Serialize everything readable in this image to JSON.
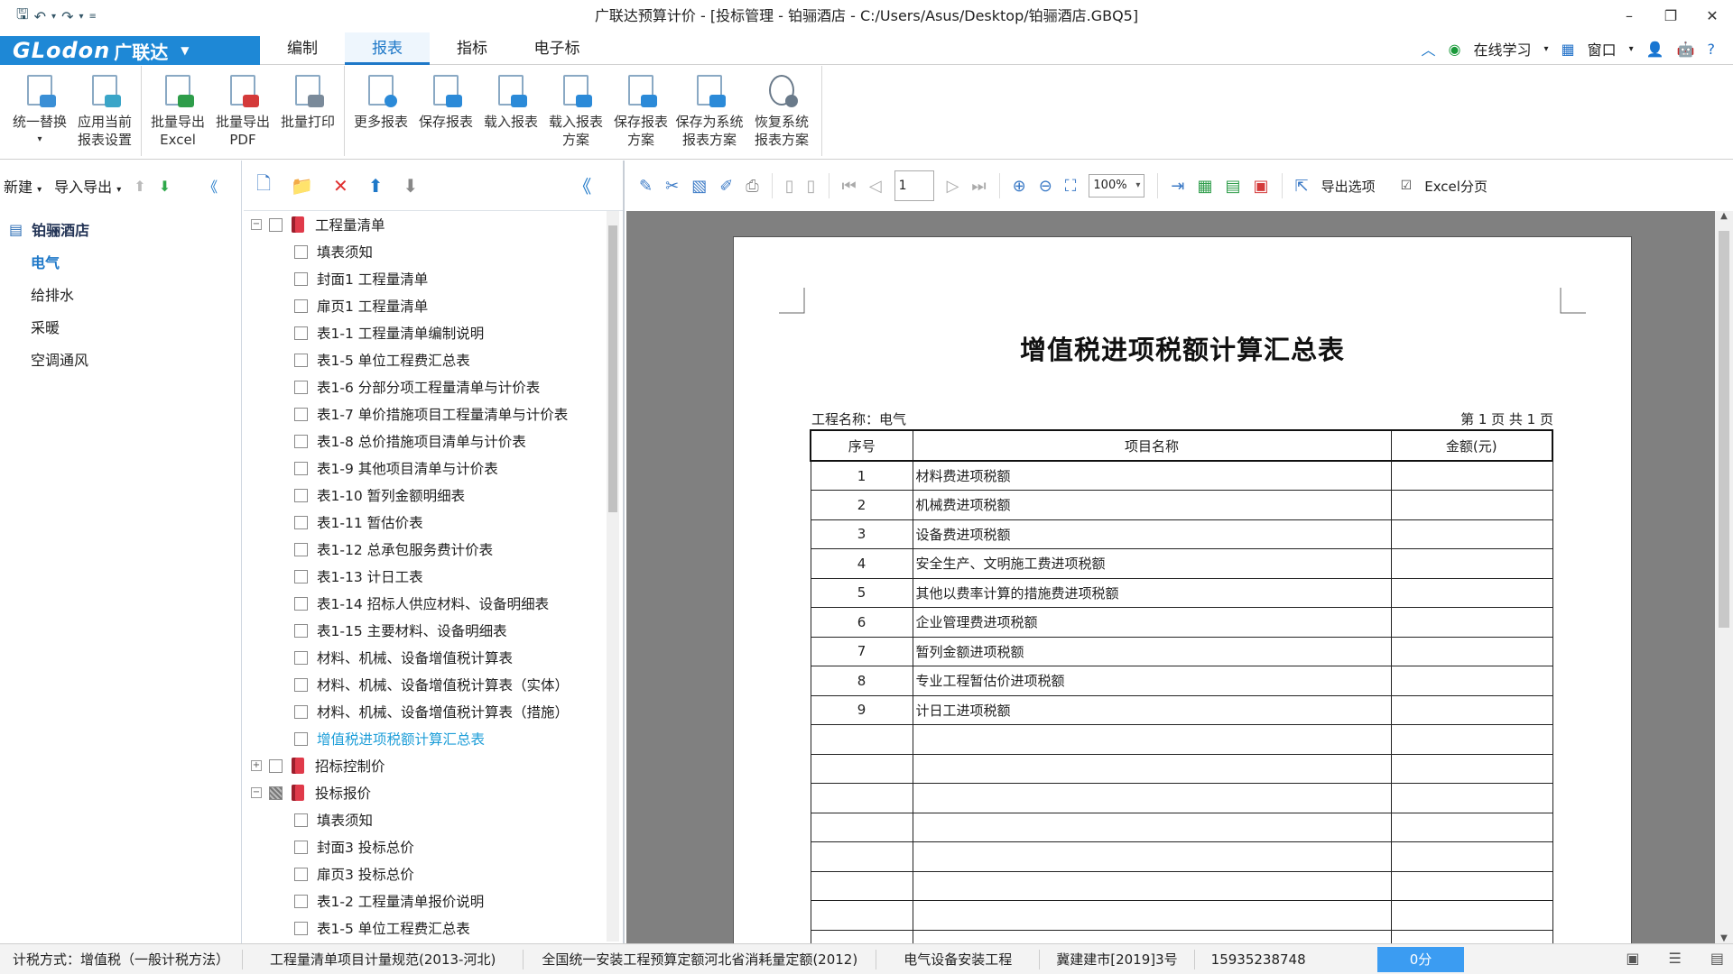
{
  "window": {
    "title": "广联达预算计价 - [投标管理 - 铂骊酒店 - C:/Users/Asus/Desktop/铂骊酒店.GBQ5]",
    "controls": [
      "–",
      "❐",
      "✕"
    ]
  },
  "menubar": {
    "logo_text": "GLodon",
    "logo_cn": "广联达",
    "tabs": [
      "编制",
      "报表",
      "指标",
      "电子标"
    ],
    "active_tab": "报表",
    "right": {
      "online_learning": "在线学习",
      "window": "窗口"
    }
  },
  "ribbon": {
    "groups": [
      [
        {
          "line1": "统一替换",
          "line2": "▾",
          "icon": "replace-icon",
          "color": "#3a8fd6"
        },
        {
          "line1": "应用当前",
          "line2": "报表设置",
          "icon": "apply-settings-icon",
          "color": "#3aa5c8"
        }
      ],
      [
        {
          "line1": "批量导出",
          "line2": "Excel",
          "icon": "excel-icon",
          "color": "#2e9d4a"
        },
        {
          "line1": "批量导出",
          "line2": "PDF",
          "icon": "pdf-icon",
          "color": "#d43a3a"
        },
        {
          "line1": "批量打印",
          "line2": "",
          "icon": "print-icon",
          "color": "#7a8a9a"
        }
      ],
      [
        {
          "line1": "更多报表",
          "line2": "",
          "icon": "more-reports-icon",
          "color": "#2b8ad8"
        },
        {
          "line1": "保存报表",
          "line2": "",
          "icon": "save-report-icon",
          "color": "#2b8ad8"
        },
        {
          "line1": "载入报表",
          "line2": "",
          "icon": "load-report-icon",
          "color": "#2b8ad8"
        },
        {
          "line1": "载入报表",
          "line2": "方案",
          "icon": "load-scheme-icon",
          "color": "#2b8ad8"
        },
        {
          "line1": "保存报表",
          "line2": "方案",
          "icon": "save-scheme-icon",
          "color": "#2b8ad8"
        },
        {
          "line1": "保存为系统",
          "line2": "报表方案",
          "icon": "save-system-scheme-icon",
          "color": "#2b8ad8"
        },
        {
          "line1": "恢复系统",
          "line2": "报表方案",
          "icon": "restore-system-icon",
          "color": "#6a7a8a"
        }
      ]
    ]
  },
  "left_panel": {
    "new_label": "新建",
    "import_export_label": "导入导出",
    "project_name": "铂骊酒店",
    "items": [
      "电气",
      "给排水",
      "采暖",
      "空调通风"
    ],
    "selected_item": "电气"
  },
  "report_tree": {
    "nodes": [
      {
        "level": 0,
        "expand": "−",
        "check": "none",
        "book": true,
        "label": "工程量清单"
      },
      {
        "level": 1,
        "label": "填表须知"
      },
      {
        "level": 1,
        "label": "封面1 工程量清单"
      },
      {
        "level": 1,
        "label": "扉页1 工程量清单"
      },
      {
        "level": 1,
        "label": "表1-1 工程量清单编制说明"
      },
      {
        "level": 1,
        "label": "表1-5 单位工程费汇总表"
      },
      {
        "level": 1,
        "label": "表1-6 分部分项工程量清单与计价表"
      },
      {
        "level": 1,
        "label": "表1-7 单价措施项目工程量清单与计价表"
      },
      {
        "level": 1,
        "label": "表1-8 总价措施项目清单与计价表"
      },
      {
        "level": 1,
        "label": "表1-9 其他项目清单与计价表"
      },
      {
        "level": 1,
        "label": "表1-10 暂列金额明细表"
      },
      {
        "level": 1,
        "label": "表1-11 暂估价表"
      },
      {
        "level": 1,
        "label": "表1-12 总承包服务费计价表"
      },
      {
        "level": 1,
        "label": "表1-13 计日工表"
      },
      {
        "level": 1,
        "label": "表1-14 招标人供应材料、设备明细表"
      },
      {
        "level": 1,
        "label": "表1-15 主要材料、设备明细表"
      },
      {
        "level": 1,
        "label": "材料、机械、设备增值税计算表"
      },
      {
        "level": 1,
        "label": "材料、机械、设备增值税计算表（实体）"
      },
      {
        "level": 1,
        "label": "材料、机械、设备增值税计算表（措施）"
      },
      {
        "level": 1,
        "label": "增值税进项税额计算汇总表",
        "highlight": true
      },
      {
        "level": 0,
        "expand": "+",
        "check": "none",
        "book": true,
        "label": "招标控制价"
      },
      {
        "level": 0,
        "expand": "−",
        "check": "part",
        "book": true,
        "label": "投标报价"
      },
      {
        "level": 1,
        "label": "填表须知"
      },
      {
        "level": 1,
        "label": "封面3 投标总价"
      },
      {
        "level": 1,
        "label": "扉页3 投标总价"
      },
      {
        "level": 1,
        "label": "表1-2 工程量清单报价说明"
      },
      {
        "level": 1,
        "label": "表1-5 单位工程费汇总表"
      }
    ]
  },
  "viewer_toolbar": {
    "page": "1",
    "zoom": "100%",
    "export_options": "导出选项",
    "excel_paging": "Excel分页"
  },
  "report": {
    "title": "增值税进项税额计算汇总表",
    "project_label": "工程名称：电气",
    "page_info": "第 1 页   共 1 页",
    "headers": [
      "序号",
      "项目名称",
      "金额(元)"
    ],
    "rows": [
      [
        "1",
        "材料费进项税额",
        ""
      ],
      [
        "2",
        "机械费进项税额",
        ""
      ],
      [
        "3",
        "设备费进项税额",
        ""
      ],
      [
        "4",
        "安全生产、文明施工费进项税额",
        ""
      ],
      [
        "5",
        "其他以费率计算的措施费进项税额",
        ""
      ],
      [
        "6",
        "企业管理费进项税额",
        ""
      ],
      [
        "7",
        "暂列金额进项税额",
        ""
      ],
      [
        "8",
        "专业工程暂估价进项税额",
        ""
      ],
      [
        "9",
        "计日工进项税额",
        ""
      ],
      [
        "",
        "",
        ""
      ],
      [
        "",
        "",
        ""
      ],
      [
        "",
        "",
        ""
      ],
      [
        "",
        "",
        ""
      ],
      [
        "",
        "",
        ""
      ],
      [
        "",
        "",
        ""
      ],
      [
        "",
        "",
        ""
      ],
      [
        "",
        "",
        ""
      ]
    ]
  },
  "statusbar": {
    "items": [
      "计税方式：增值税（一般计税方法）",
      "工程量清单项目计量规范(2013-河北)",
      "全国统一安装工程预算定额河北省消耗量定额(2012)",
      "电气设备安装工程",
      "冀建建市[2019]3号",
      "15935238748"
    ],
    "score": "0分"
  }
}
